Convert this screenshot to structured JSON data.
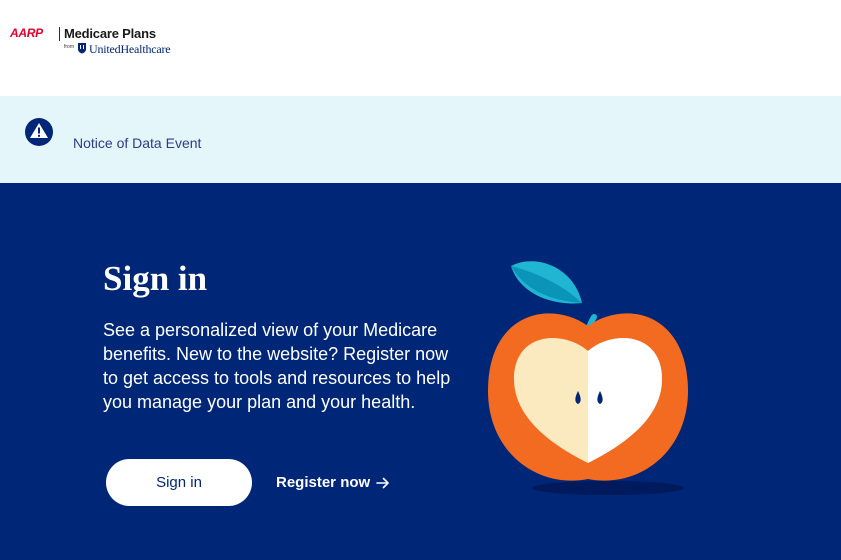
{
  "header": {
    "logo": {
      "brand": "AARP",
      "product": "Medicare Plans",
      "from_text": "from",
      "partner": "UnitedHealthcare"
    }
  },
  "notice": {
    "icon": "warning-icon",
    "link_label": "Notice of Data Event"
  },
  "hero": {
    "title": "Sign in",
    "description": "See a personalized view of your Medicare benefits. New to the website? Register now to get access to tools and resources to help you manage your plan and your health.",
    "signin_button_label": "Sign in",
    "register_link_label": "Register now"
  },
  "colors": {
    "hero_background": "#002677",
    "notice_background": "#e5f6fa",
    "aarp_red": "#e4002b",
    "apple_orange": "#f26b21",
    "leaf_teal": "#20b5d3"
  }
}
